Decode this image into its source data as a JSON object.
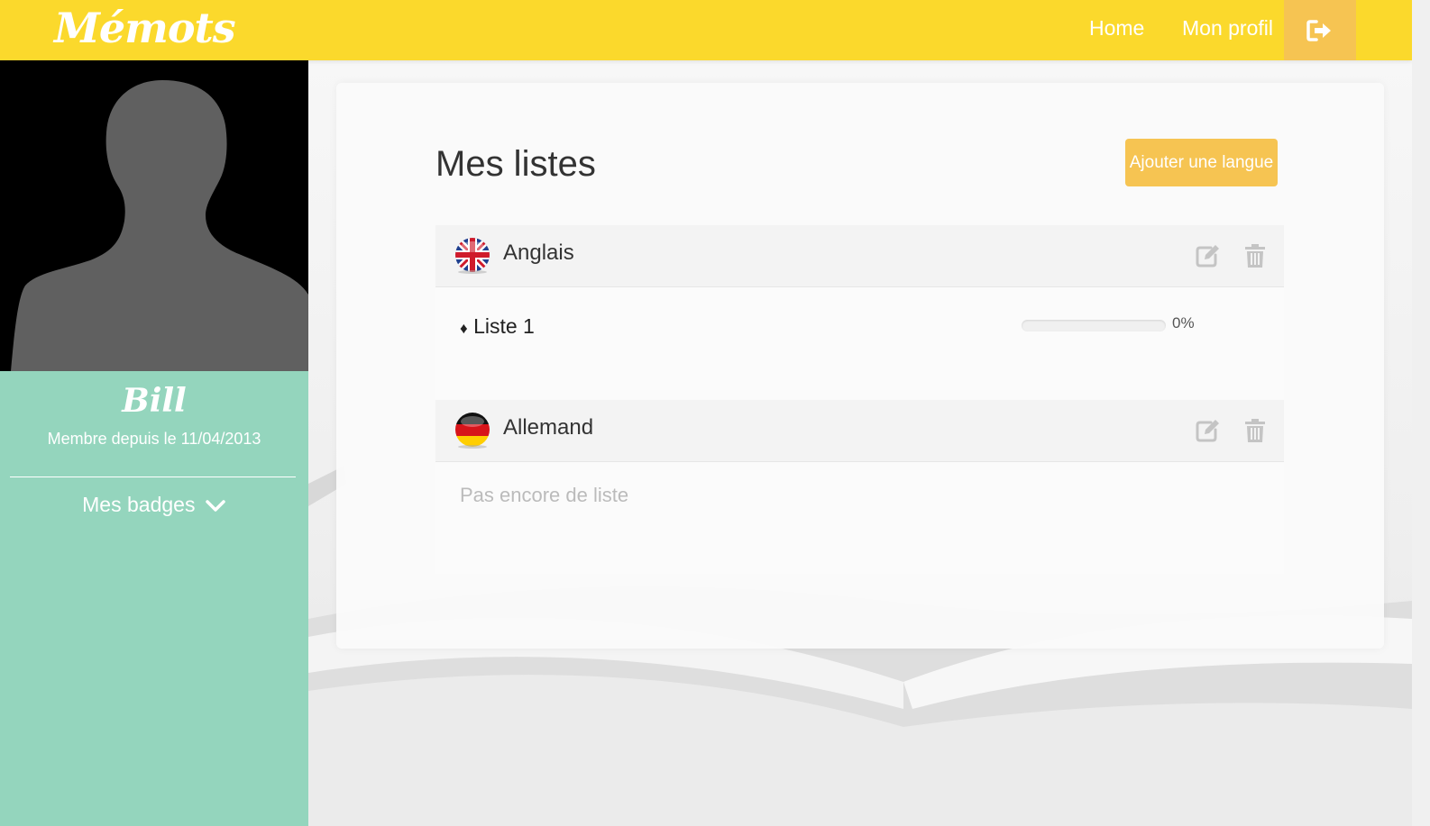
{
  "header": {
    "logo": "Mémots",
    "nav": [
      {
        "label": "Home"
      },
      {
        "label": "Mon profil"
      }
    ],
    "logout_icon": "sign-out-icon"
  },
  "sidebar": {
    "avatar_icon": "user-silhouette",
    "user_name": "Bill",
    "member_since": "Membre depuis le 11/04/2013",
    "badges_label": "Mes badges",
    "badges_icon": "chevron-down-icon"
  },
  "main": {
    "title": "Mes listes",
    "add_language_button": "Ajouter une langue",
    "languages": [
      {
        "name": "Anglais",
        "flag": "uk-flag",
        "lists": [
          {
            "bullet": "♦",
            "name": "Liste 1",
            "progress": 0,
            "progress_label": "0%"
          }
        ]
      },
      {
        "name": "Allemand",
        "flag": "germany-flag",
        "empty_message": "Pas encore de liste"
      }
    ]
  },
  "colors": {
    "header_yellow": "#fbd92c",
    "accent_orange": "#f6c452",
    "sidebar_green": "#94d5bd"
  }
}
